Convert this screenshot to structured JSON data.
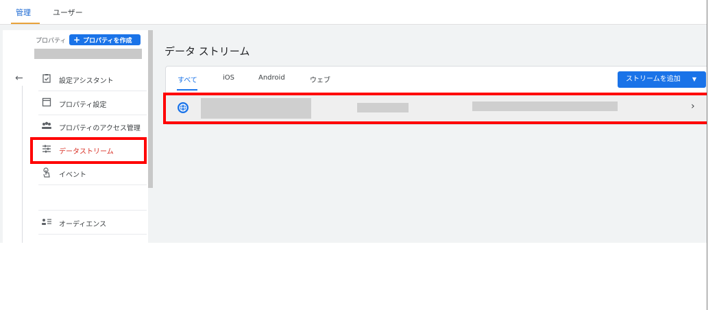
{
  "top_tabs": [
    {
      "label": "管理",
      "active": true
    },
    {
      "label": "ユーザー",
      "active": false
    }
  ],
  "sidebar": {
    "property_label": "プロパティ",
    "create_button": "プロパティを作成",
    "items": [
      {
        "label": "設定アシスタント",
        "icon": "clipboard-check-icon"
      },
      {
        "label": "プロパティ設定",
        "icon": "window-icon"
      },
      {
        "label": "プロパティのアクセス管理",
        "icon": "people-icon"
      },
      {
        "label": "データストリーム",
        "icon": "data-stream-icon",
        "active": true
      },
      {
        "label": "イベント",
        "icon": "touch-icon"
      },
      {
        "label": "オーディエンス",
        "icon": "audience-icon"
      }
    ]
  },
  "main": {
    "title": "データ ストリーム",
    "tabs": [
      {
        "label": "すべて",
        "active": true
      },
      {
        "label": "iOS"
      },
      {
        "label": "Android"
      },
      {
        "label": "ウェブ"
      }
    ],
    "add_button": "ストリームを追加"
  },
  "colors": {
    "accent": "#1a73e8",
    "highlight": "#ff0000",
    "active_text": "#d93025"
  }
}
